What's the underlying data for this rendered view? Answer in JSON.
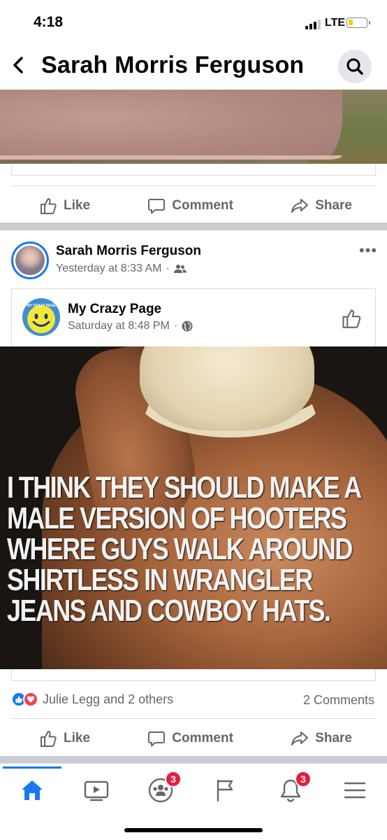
{
  "status_bar": {
    "time": "4:18",
    "network": "LTE"
  },
  "header": {
    "title": "Sarah Morris Ferguson"
  },
  "first_post": {
    "actions": {
      "like": "Like",
      "comment": "Comment",
      "share": "Share"
    }
  },
  "post": {
    "author": "Sarah Morris Ferguson",
    "timestamp": "Yesterday at 8:33 AM",
    "audience_icon": "friends-icon",
    "shared": {
      "page_name": "My Crazy Page",
      "page_avatar_text": "MY CRAZY PAGE",
      "timestamp": "Saturday at 8:48 PM",
      "audience_icon": "globe-icon",
      "image_text": "I THINK THEY SHOULD MAKE A\nMALE VERSION OF HOOTERS\nWHERE GUYS WALK AROUND\nSHIRTLESS IN WRANGLER\nJEANS AND COWBOY HATS."
    },
    "reactions_text": "Julie Legg and 2 others",
    "comments_count": "2 Comments",
    "actions": {
      "like": "Like",
      "comment": "Comment",
      "share": "Share"
    }
  },
  "tab_bar": {
    "tabs": [
      {
        "name": "home",
        "icon": "home-icon",
        "active": true
      },
      {
        "name": "watch",
        "icon": "video-icon"
      },
      {
        "name": "groups",
        "icon": "groups-icon",
        "badge": "3"
      },
      {
        "name": "pages",
        "icon": "flag-icon"
      },
      {
        "name": "notifications",
        "icon": "bell-icon",
        "badge": "3"
      },
      {
        "name": "menu",
        "icon": "menu-icon"
      }
    ]
  },
  "colors": {
    "accent": "#1877f2",
    "badge": "#e41e3f",
    "muted": "#65676b"
  }
}
